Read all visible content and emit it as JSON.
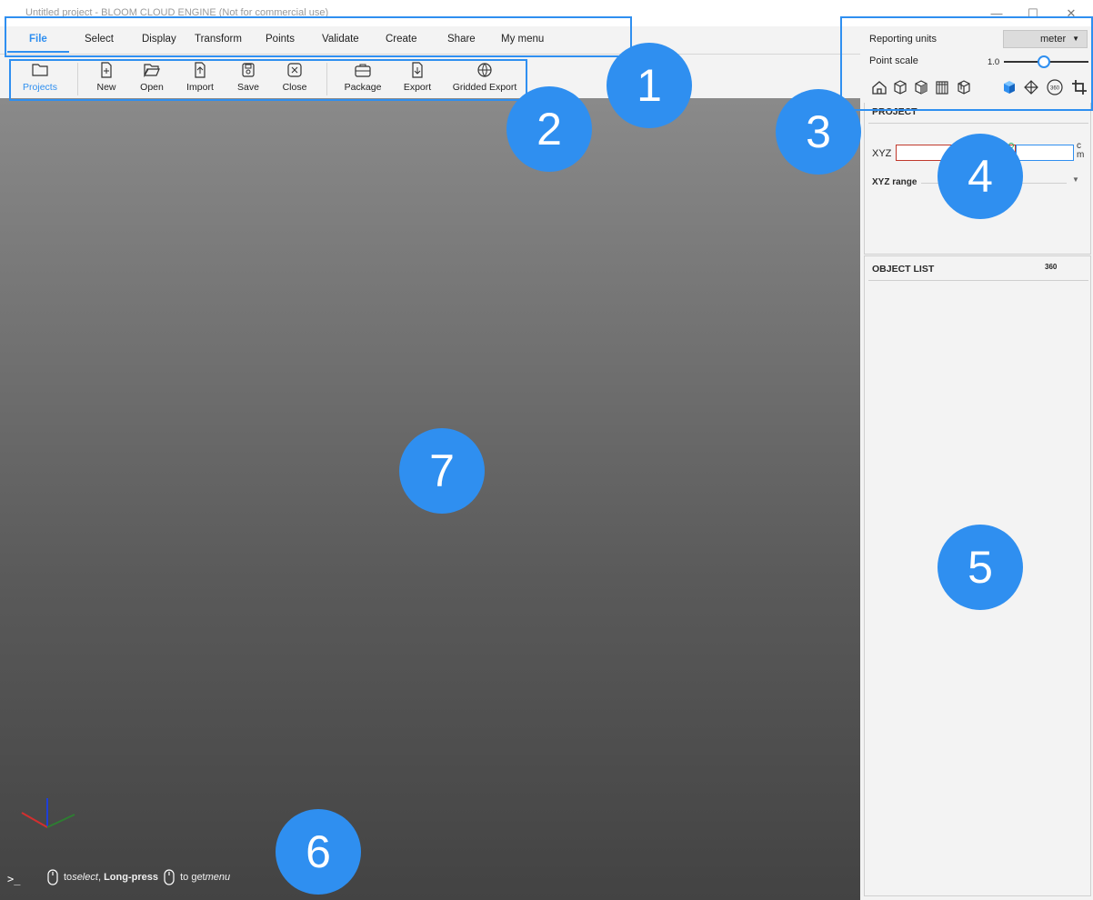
{
  "window": {
    "title": "Untitled project - BLOOM CLOUD ENGINE (Not for commercial use)",
    "controls": [
      "—",
      "☐",
      "✕"
    ]
  },
  "menu": {
    "items": [
      "File",
      "Select",
      "Display",
      "Transform",
      "Points",
      "Validate",
      "Create",
      "Share",
      "My menu"
    ],
    "active": "File"
  },
  "toolbar": {
    "tools": [
      {
        "label": "Projects",
        "icon": "folder-icon"
      },
      {
        "label": "New",
        "icon": "new-file-icon"
      },
      {
        "label": "Open",
        "icon": "open-folder-icon"
      },
      {
        "label": "Import",
        "icon": "import-icon"
      },
      {
        "label": "Save",
        "icon": "save-icon"
      },
      {
        "label": "Close",
        "icon": "close-box-icon"
      },
      {
        "label": "Package",
        "icon": "briefcase-icon"
      },
      {
        "label": "Export",
        "icon": "export-icon"
      },
      {
        "label": "Gridded Export",
        "icon": "globe-grid-icon"
      }
    ]
  },
  "settings": {
    "reporting_units_label": "Reporting units",
    "reporting_units_value": "meter",
    "point_scale_label": "Point scale",
    "point_scale_value": "1.0",
    "view_icons": [
      "home-icon",
      "cube-front-icon",
      "cube-side-icon",
      "cube-top-icon",
      "cube-iso-icon",
      "cube-solid-icon",
      "cube-outline-icon",
      "view-360-icon",
      "crop-icon"
    ]
  },
  "project": {
    "title": "PROJECT",
    "xyz_label": "XYZ",
    "unit_c": "c",
    "unit_m": "m",
    "xyz_range_label": "XYZ range"
  },
  "object_list": {
    "title": "OBJECT LIST",
    "icon_label": "360"
  },
  "status": {
    "console_prompt": ">_",
    "hint_part1": "to ",
    "hint_select": "select",
    "hint_part2": ",",
    "hint_longpress": "Long-press",
    "hint_part3": "to get ",
    "hint_menu": "menu"
  },
  "annotations": [
    "1",
    "2",
    "3",
    "4",
    "5",
    "6",
    "7"
  ],
  "colors": {
    "accent": "#2f8ff0",
    "axis_x": "#d32f2f",
    "axis_y": "#2e7d32",
    "axis_z": "#1e3fd8"
  }
}
